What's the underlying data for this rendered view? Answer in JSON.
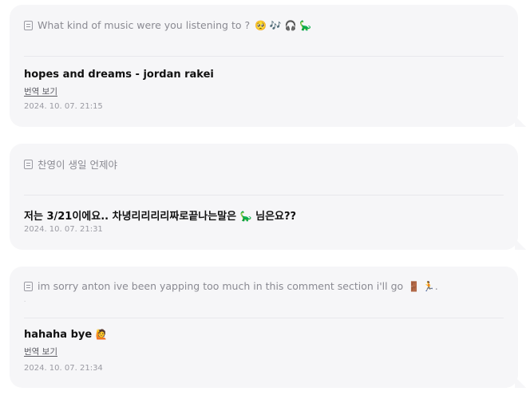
{
  "cards": [
    {
      "question": "What kind of music were you listening to ?",
      "question_emoji": "🥺 🎶 🎧 🦕",
      "answer": "hopes and dreams - jordan rakei",
      "translate_label": "번역 보기",
      "timestamp": "2024. 10. 07. 21:15"
    },
    {
      "question": "찬영이 생일 언제야",
      "answer": "저는 3/21이에요.. 차녕리리리리짜로끝나는말은",
      "answer_emoji": "🦕",
      "answer_tail": "님은요??",
      "timestamp": "2024. 10. 07. 21:31"
    },
    {
      "question": "im sorry anton ive been yapping too much in this comment section i'll go",
      "question_emoji": "🚪 🏃.",
      "question_extra": ".",
      "answer": "hahaha bye",
      "answer_emoji": "🙋",
      "translate_label": "번역 보기",
      "timestamp": "2024. 10. 07. 21:34"
    }
  ]
}
